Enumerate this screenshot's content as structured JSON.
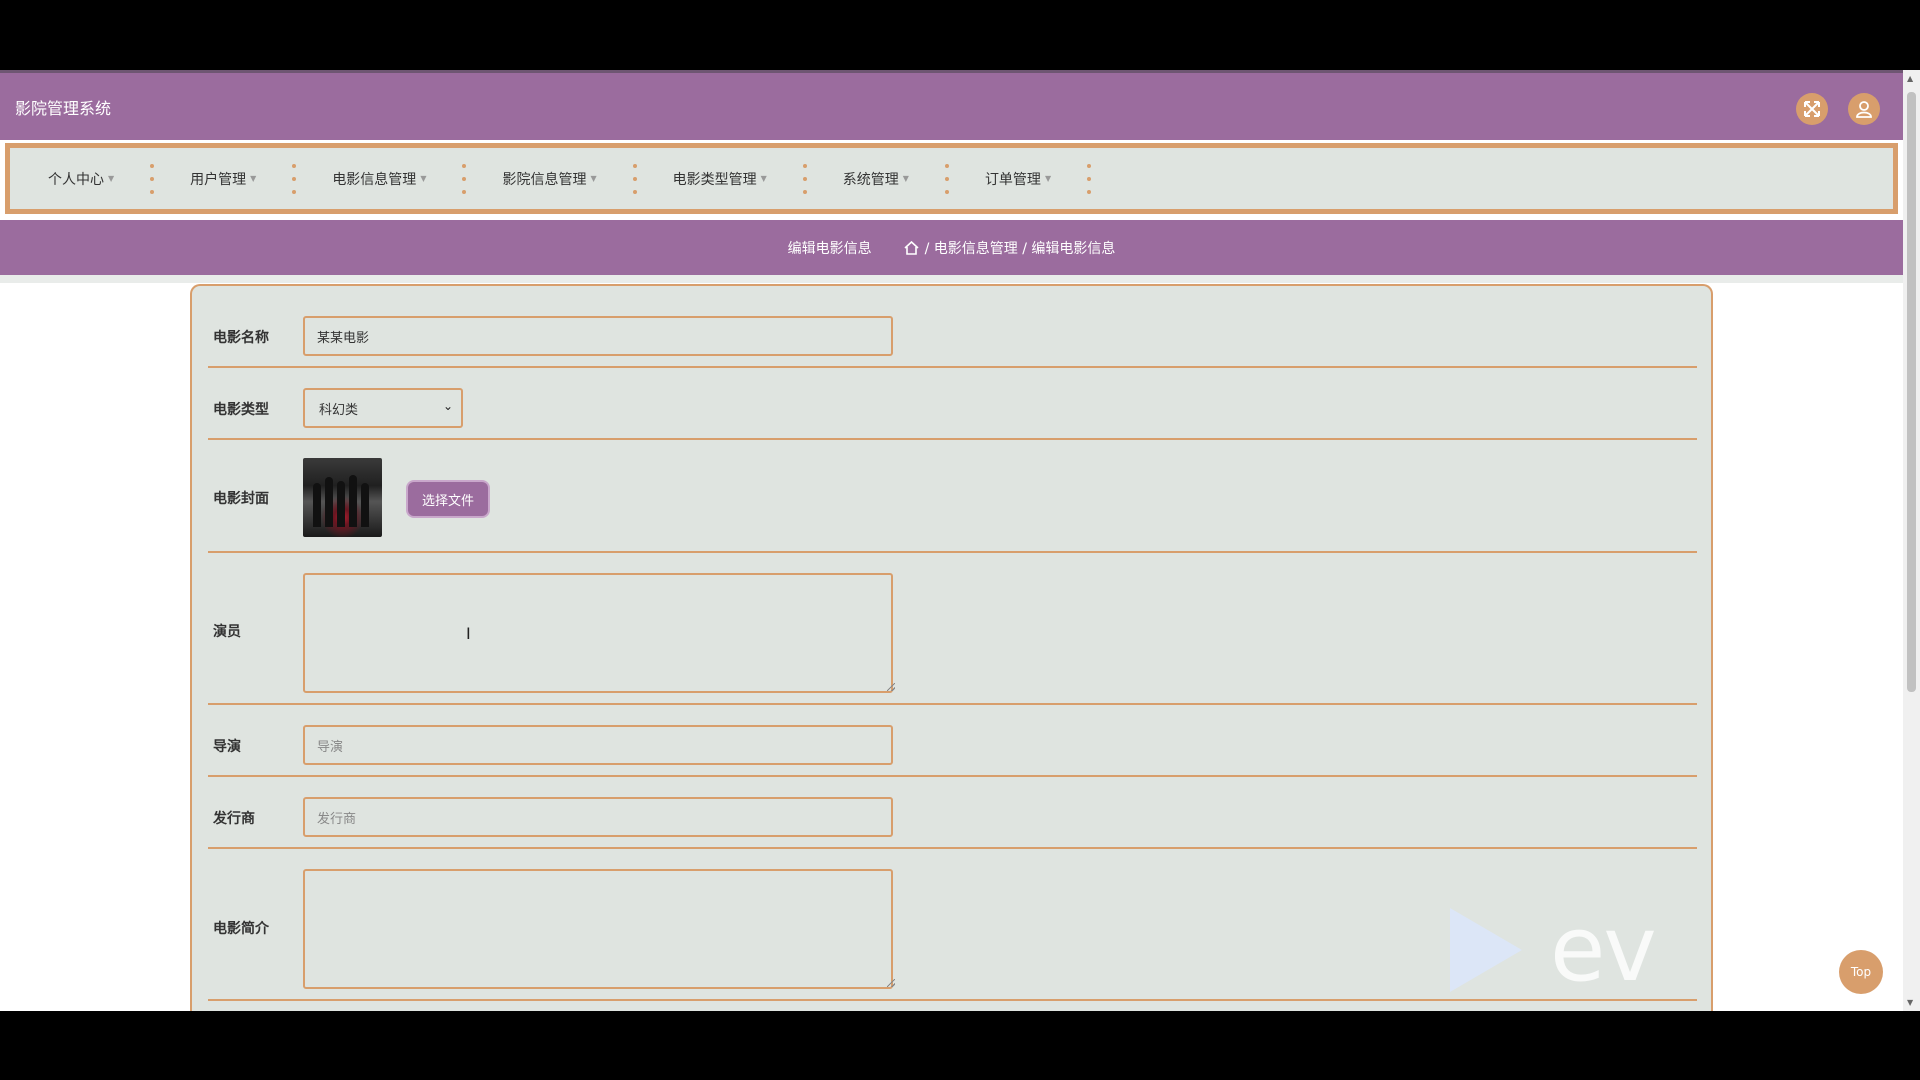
{
  "app": {
    "title": "影院管理系统"
  },
  "top_icons": {
    "fullscreen": "fullscreen-icon",
    "user": "user-icon"
  },
  "nav": {
    "items": [
      {
        "label": "个人中心"
      },
      {
        "label": "用户管理"
      },
      {
        "label": "电影信息管理"
      },
      {
        "label": "影院信息管理"
      },
      {
        "label": "电影类型管理"
      },
      {
        "label": "系统管理"
      },
      {
        "label": "订单管理"
      }
    ]
  },
  "breadcrumb": {
    "page_title": "编辑电影信息",
    "path": "/ 电影信息管理 / 编辑电影信息"
  },
  "form": {
    "movie_name": {
      "label": "电影名称",
      "value": "某某电影"
    },
    "movie_type": {
      "label": "电影类型",
      "value": "科幻类"
    },
    "cover": {
      "label": "电影封面",
      "button": "选择文件"
    },
    "actors": {
      "label": "演员",
      "value": ""
    },
    "director": {
      "label": "导演",
      "placeholder": "导演"
    },
    "publisher": {
      "label": "发行商",
      "placeholder": "发行商"
    },
    "intro": {
      "label": "电影简介",
      "value": ""
    }
  },
  "top_button": {
    "label": "Top"
  },
  "watermark": {
    "text": "ev"
  },
  "colors": {
    "primary": "#9b6c9e",
    "accent": "#d89e6c",
    "panel": "#dfe4e0"
  }
}
